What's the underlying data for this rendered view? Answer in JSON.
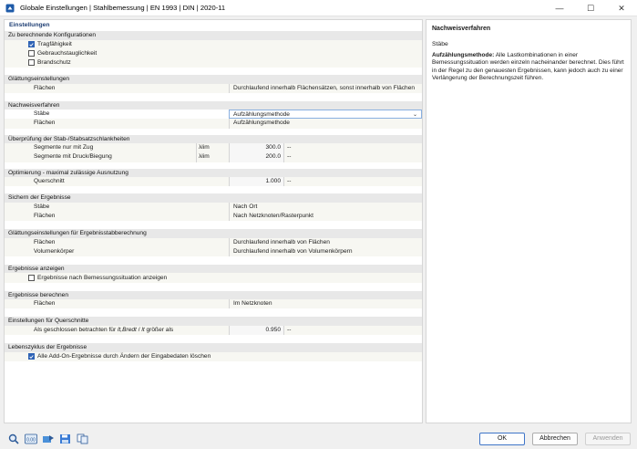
{
  "window": {
    "title": "Globale Einstellungen | Stahlbemessung | EN 1993 | DIN | 2020-11",
    "minimize": "—",
    "maximize": "☐",
    "close": "✕"
  },
  "left": {
    "header": "Einstellungen",
    "configs": {
      "title": "Zu berechnende Konfigurationen",
      "items": [
        {
          "label": "Tragfähigkeit",
          "checked": true
        },
        {
          "label": "Gebrauchstauglichkeit",
          "checked": false
        },
        {
          "label": "Brandschutz",
          "checked": false
        }
      ]
    },
    "smoothing": {
      "title": "Glättungseinstellungen",
      "row_label": "Flächen",
      "row_value": "Durchlaufend innerhalb Flächensätzen, sonst innerhalb von Flächen"
    },
    "method": {
      "title": "Nachweisverfahren",
      "staebe_label": "Stäbe",
      "staebe_value": "Aufzählungsmethode",
      "flaechen_label": "Flächen",
      "flaechen_value": "Aufzählungsmethode"
    },
    "slenderness": {
      "title": "Überprüfung der Stab-/Stabsatzschlankheiten",
      "rows": [
        {
          "label": "Segmente nur mit Zug",
          "symbol": "λlim",
          "value": "300.0",
          "unit": "--"
        },
        {
          "label": "Segmente mit Druck/Biegung",
          "symbol": "λlim",
          "value": "200.0",
          "unit": "--"
        }
      ]
    },
    "optimization": {
      "title": "Optimierung - maximal zulässige Ausnutzung",
      "row_label": "Querschnitt",
      "row_value": "1.000",
      "row_unit": "--"
    },
    "save": {
      "title": "Sichern der Ergebnisse",
      "staebe_label": "Stäbe",
      "staebe_value": "Nach Ort",
      "flaechen_label": "Flächen",
      "flaechen_value": "Nach Netzknoten/Rasterpunkt"
    },
    "smoothing_results": {
      "title": "Glättungseinstellungen für Ergebnisstabberechnung",
      "flaechen_label": "Flächen",
      "flaechen_value": "Durchlaufend innerhalb von Flächen",
      "vol_label": "Volumenkörper",
      "vol_value": "Durchlaufend innerhalb von Volumenkörpern"
    },
    "show_results": {
      "title": "Ergebnisse anzeigen",
      "item_label": "Ergebnisse nach Bemessungssituation anzeigen",
      "checked": false
    },
    "calc_results": {
      "title": "Ergebnisse berechnen",
      "flaechen_label": "Flächen",
      "flaechen_value": "Im Netzknoten"
    },
    "cross_sections": {
      "title": "Einstellungen für Querschnitte",
      "row_label_prefix": "Als geschlossen betrachten für ",
      "row_sym": "lt,Bredt",
      "row_label_mid": " / ",
      "row_sym2": "lt",
      "row_label_suffix": " größer als",
      "row_value": "0.950",
      "row_unit": "--"
    },
    "lifecycle": {
      "title": "Lebenszyklus der Ergebnisse",
      "item_label": "Alle Add-On-Ergebnisse durch Ändern der Eingabedaten löschen",
      "checked": true
    }
  },
  "right": {
    "title": "Nachweisverfahren",
    "subtitle": "Stäbe",
    "bold_term": "Aufzählungsmethode:",
    "text": " Alle Lastkombinationen in einer Bemessungssituation werden einzeln nacheinander berechnet. Dies führt in der Regel zu den genauesten Ergebnissen, kann jedoch auch zu einer Verlängerung der Berechnungszeit führen."
  },
  "footer": {
    "ok": "OK",
    "cancel": "Abbrechen",
    "apply": "Anwenden",
    "tools": [
      "search-icon",
      "units-icon",
      "transfer-icon",
      "save-icon",
      "copy-icon"
    ],
    "units_label": "0.00"
  }
}
